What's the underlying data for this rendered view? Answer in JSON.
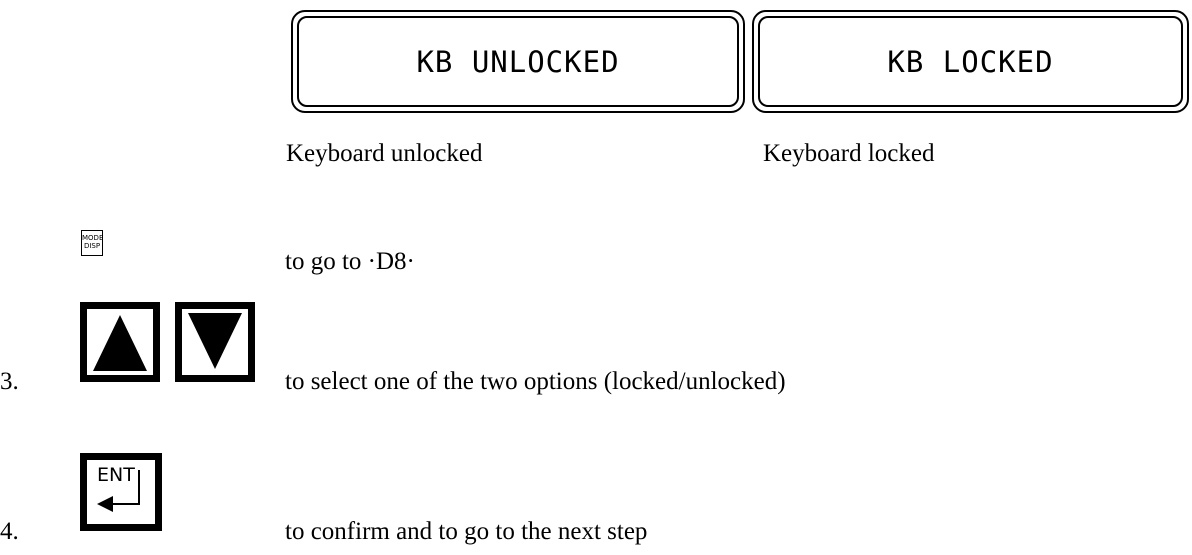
{
  "displays": {
    "unlocked_text": "KB UNLOCKED",
    "locked_text": "KB LOCKED"
  },
  "captions": {
    "unlocked": "Keyboard unlocked",
    "locked": "Keyboard locked"
  },
  "keys": {
    "mode_line1": "MODE",
    "mode_line2": "DISP",
    "enter_label": "ENT"
  },
  "steps": [
    {
      "number": "",
      "text": "to go to ·D8·"
    },
    {
      "number": "3.",
      "text": "to select one of the two options (locked/unlocked)"
    },
    {
      "number": "4.",
      "text": "to confirm and to go to the next step"
    }
  ],
  "icons": [
    "mode-disp-key-icon",
    "up-arrow-key-icon",
    "down-arrow-key-icon",
    "enter-key-icon"
  ]
}
